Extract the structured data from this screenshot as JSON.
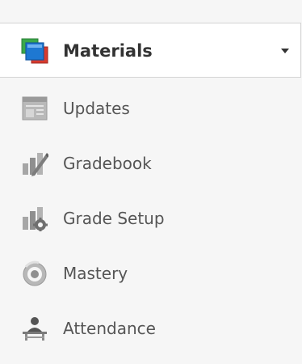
{
  "sidebar": {
    "selected": {
      "label": "Materials",
      "icon": "materials-icon",
      "caret_icon": "caret-down-icon"
    },
    "items": [
      {
        "label": "Updates",
        "icon": "updates-icon"
      },
      {
        "label": "Gradebook",
        "icon": "gradebook-icon"
      },
      {
        "label": "Grade Setup",
        "icon": "grade-setup-icon"
      },
      {
        "label": "Mastery",
        "icon": "mastery-icon"
      },
      {
        "label": "Attendance",
        "icon": "attendance-icon"
      }
    ]
  },
  "colors": {
    "sidebar_bg": "#f6f6f6",
    "selected_bg": "#ffffff",
    "label_text": "#555555",
    "selected_text": "#333333",
    "icon_gray": "#9a9a9a",
    "materials_blue": "#1e78d2",
    "materials_green": "#3aa84a",
    "materials_red": "#d83a2e"
  }
}
